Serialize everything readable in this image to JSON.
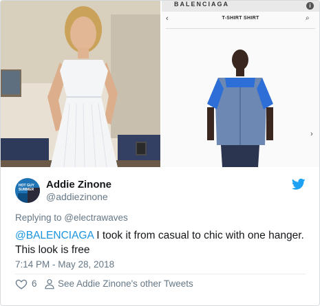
{
  "media": {
    "phone_brand": "BALENCIAGA",
    "phone_title": "T-SHIRT SHIRT",
    "nav_left_glyph": "‹",
    "nav_right_glyph": "›",
    "info_glyph": "i"
  },
  "author": {
    "name": "Addie Zinone",
    "handle": "@addiezinone",
    "avatar_caption": "HOT GUY SUMMER"
  },
  "tweet": {
    "reply_prefix": "Replying to ",
    "reply_to": "@electrawaves",
    "mention": "@BALENCIAGA",
    "text": " I took it from casual to chic with one hanger. This look is free",
    "timestamp": "7:14 PM - May 28, 2018"
  },
  "actions": {
    "like_count": "6",
    "other_tweets": "See Addie Zinone's other Tweets"
  },
  "colors": {
    "link": "#1b95e0",
    "secondary_text": "#657786",
    "twitter_blue": "#1da1f2"
  }
}
